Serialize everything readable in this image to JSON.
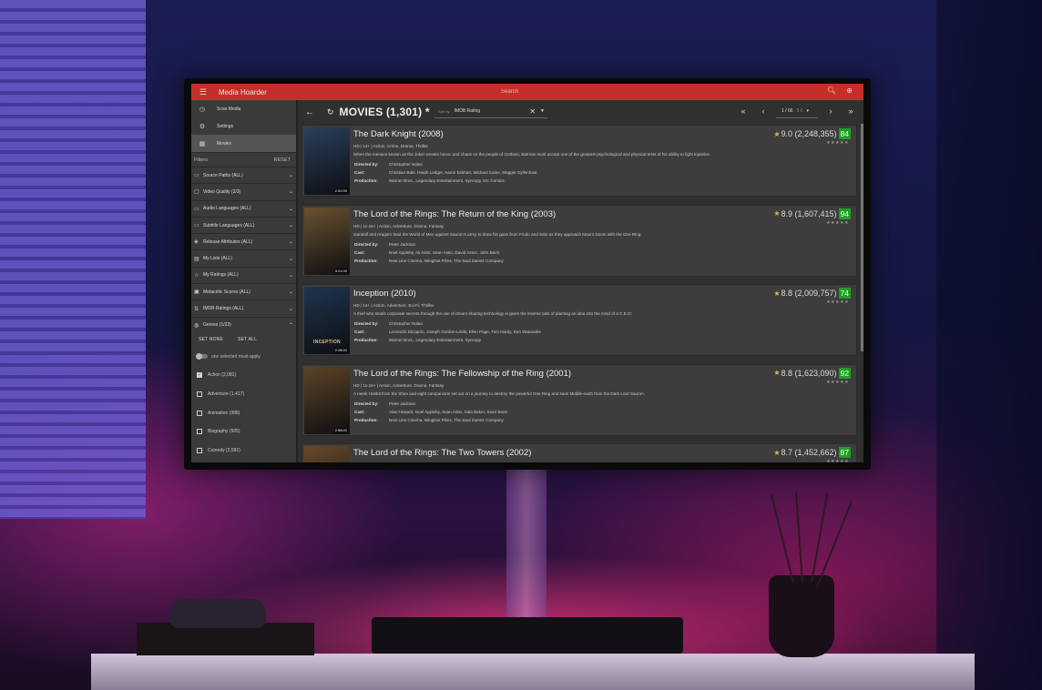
{
  "header": {
    "app_title": "Media Hoarder",
    "search_placeholder": "Search",
    "icons": {
      "menu": "menu-icon",
      "search": "search-icon",
      "account": "account-icon"
    }
  },
  "sidebar": {
    "nav": [
      {
        "icon": "history-icon",
        "label": "Scan Media"
      },
      {
        "icon": "gear-icon",
        "label": "Settings"
      },
      {
        "icon": "movie-icon",
        "label": "Movies",
        "active": true
      }
    ],
    "filters_label": "Filters",
    "reset_label": "RESET",
    "filters": [
      {
        "icon": "folder-icon",
        "label": "Source Paths (ALL)"
      },
      {
        "icon": "video-icon",
        "label": "Video Quality (2/3)"
      },
      {
        "icon": "audio-icon",
        "label": "Audio Languages (ALL)"
      },
      {
        "icon": "subtitle-icon",
        "label": "Subtitle Languages (ALL)"
      },
      {
        "icon": "attribute-icon",
        "label": "Release Attributes (ALL)"
      },
      {
        "icon": "list-icon",
        "label": "My Lists (ALL)"
      },
      {
        "icon": "star-outline-icon",
        "label": "My Ratings (ALL)"
      },
      {
        "icon": "metacritic-icon",
        "label": "Metacritic Scores (ALL)"
      },
      {
        "icon": "imdb-icon",
        "label": "IMDB Ratings (ALL)"
      }
    ],
    "genres": {
      "label": "Genres (1/23)",
      "set_none": "SET NONE",
      "set_all": "SET ALL",
      "toggle_label": "one selected must apply",
      "items": [
        {
          "label": "Action (2,081)",
          "checked": true
        },
        {
          "label": "Adventure (1,417)",
          "checked": false
        },
        {
          "label": "Animation (386)",
          "checked": false
        },
        {
          "label": "Biography (505)",
          "checked": false
        },
        {
          "label": "Comedy (3,581)",
          "checked": false
        }
      ]
    }
  },
  "toolbar": {
    "title": "MOVIES (1,301) *",
    "sort_label": "Sort by",
    "sort_value": "IMDB Rating",
    "page": "1 / 66",
    "page_size": "5 0"
  },
  "labels": {
    "directed_by": "Directed by:",
    "cast": "Cast:",
    "production": "Production:"
  },
  "movies": [
    {
      "title": "The Dark Knight (2008)",
      "rating": "9.0 (2,248,355)",
      "metascore": "84",
      "meta": "HD | 14+ | Action, Crime, Drama, Thriller",
      "description": "When the menace known as the Joker wreaks havoc and chaos on the people of Gotham, Batman must accept one of the greatest psychological and physical tests of his ability to fight injustice.",
      "director": "Christopher Nolan",
      "cast": "Christian Bale, Heath Ledger, Aaron Eckhart, Michael Caine, Maggie Gyllenhaal",
      "production": "Warner Bros., Legendary Entertainment, Syncopy, DC Comics",
      "runtime": "2:32:00",
      "poster_color": "#2a3f5c"
    },
    {
      "title": "The Lord of the Rings: The Return of the King (2003)",
      "rating": "8.9 (1,607,415)",
      "metascore": "94",
      "meta": "HD | 11-16+ | Action, Adventure, Drama, Fantasy",
      "description": "Gandalf and Aragorn lead the World of Men against Sauron's army to draw his gaze from Frodo and Sam as they approach Mount Doom with the One Ring.",
      "director": "Peter Jackson",
      "cast": "Noel Appleby, Ali Astin, Sean Astin, David Aston, John Bach",
      "production": "New Line Cinema, WingNut Films, The Saul Zaentz Company",
      "runtime": "3:21:00",
      "poster_color": "#6a5230"
    },
    {
      "title": "Inception (2010)",
      "rating": "8.8 (2,009,757)",
      "metascore": "74",
      "meta": "HD | 14+ | Action, Adventure, Sci-Fi, Thriller",
      "description": "A thief who steals corporate secrets through the use of dream-sharing technology is given the inverse task of planting an idea into the mind of a C.E.O.",
      "director": "Christopher Nolan",
      "cast": "Leonardo DiCaprio, Joseph Gordon-Levitt, Ellen Page, Tom Hardy, Ken Watanabe",
      "production": "Warner Bros., Legendary Entertainment, Syncopy",
      "runtime": "2:28:00",
      "poster_color": "#1e3550",
      "poster_text": "INCEPTION"
    },
    {
      "title": "The Lord of the Rings: The Fellowship of the Ring (2001)",
      "rating": "8.8 (1,623,090)",
      "metascore": "92",
      "meta": "HD | 11-16+ | Action, Adventure, Drama, Fantasy",
      "description": "A meek Hobbit from the Shire and eight companions set out on a journey to destroy the powerful One Ring and save Middle-earth from the Dark Lord Sauron.",
      "director": "Peter Jackson",
      "cast": "Alan Howard, Noel Appleby, Sean Astin, Sala Baker, Sean Bean",
      "production": "New Line Cinema, WingNut Films, The Saul Zaentz Company",
      "runtime": "2:58:00",
      "poster_color": "#5c4426"
    },
    {
      "title": "The Lord of the Rings: The Two Towers (2002)",
      "rating": "8.7 (1,452,662)",
      "metascore": "87",
      "meta": "",
      "description": "",
      "director": "",
      "cast": "",
      "production": "",
      "runtime": "",
      "poster_color": "#6a4a2a"
    }
  ]
}
